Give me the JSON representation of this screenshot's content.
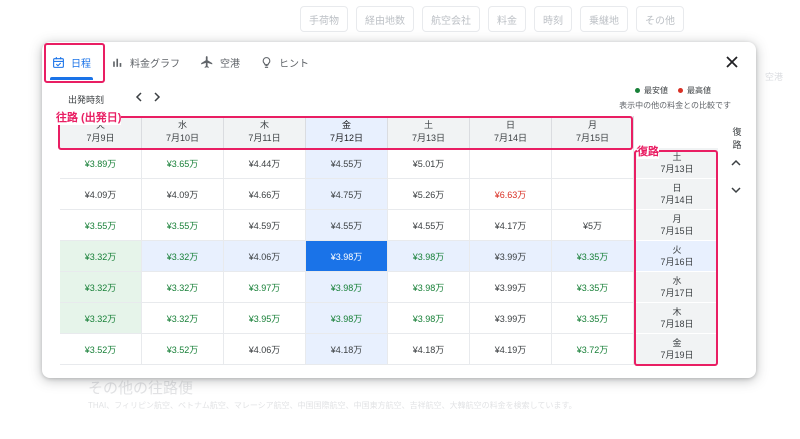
{
  "background": {
    "filters": [
      "手荷物",
      "経由地数",
      "航空会社",
      "料金",
      "時刻",
      "乗継地",
      "その他"
    ],
    "bottom_title": "その他の往路便",
    "bottom_sub": "THAI、フィリピン航空、ベトナム航空、マレーシア航空、中国国際航空、中国東方航空、吉祥航空、大韓航空の料金を検索しています。",
    "right_text": "空港"
  },
  "tabs": [
    {
      "label": "日程",
      "icon": "calendar-icon",
      "active": true
    },
    {
      "label": "料金グラフ",
      "icon": "bar-chart-icon",
      "active": false
    },
    {
      "label": "空港",
      "icon": "airplane-icon",
      "active": false
    },
    {
      "label": "ヒント",
      "icon": "lightbulb-icon",
      "active": false
    }
  ],
  "departure_time_label": "出発時刻",
  "legend": {
    "lowest": "最安値",
    "highest": "最高値",
    "lowest_color": "#188038",
    "highest_color": "#d93025"
  },
  "compare_note": "表示中の他の料金との比較です",
  "return_label": "復路",
  "columns": [
    {
      "day": "火",
      "date": "7月9日"
    },
    {
      "day": "水",
      "date": "7月10日"
    },
    {
      "day": "木",
      "date": "7月11日"
    },
    {
      "day": "金",
      "date": "7月12日"
    },
    {
      "day": "土",
      "date": "7月13日"
    },
    {
      "day": "日",
      "date": "7月14日"
    },
    {
      "day": "月",
      "date": "7月15日"
    }
  ],
  "rows": [
    {
      "day": "土",
      "date": "7月13日"
    },
    {
      "day": "日",
      "date": "7月14日"
    },
    {
      "day": "月",
      "date": "7月15日"
    },
    {
      "day": "火",
      "date": "7月16日"
    },
    {
      "day": "水",
      "date": "7月17日"
    },
    {
      "day": "木",
      "date": "7月18日"
    },
    {
      "day": "金",
      "date": "7月19日"
    }
  ],
  "prices": [
    [
      {
        "v": "¥3.89万",
        "c": "green"
      },
      {
        "v": "¥3.65万",
        "c": "green"
      },
      {
        "v": "¥4.44万",
        "c": "normal"
      },
      {
        "v": "¥4.55万",
        "c": "normal"
      },
      {
        "v": "¥5.01万",
        "c": "normal"
      },
      {
        "v": "",
        "c": "normal"
      },
      {
        "v": "",
        "c": "normal"
      }
    ],
    [
      {
        "v": "¥4.09万",
        "c": "normal"
      },
      {
        "v": "¥4.09万",
        "c": "normal"
      },
      {
        "v": "¥4.66万",
        "c": "normal"
      },
      {
        "v": "¥4.75万",
        "c": "normal"
      },
      {
        "v": "¥5.26万",
        "c": "normal"
      },
      {
        "v": "¥6.63万",
        "c": "red"
      },
      {
        "v": "",
        "c": "normal"
      }
    ],
    [
      {
        "v": "¥3.55万",
        "c": "green"
      },
      {
        "v": "¥3.55万",
        "c": "green"
      },
      {
        "v": "¥4.59万",
        "c": "normal"
      },
      {
        "v": "¥4.55万",
        "c": "normal"
      },
      {
        "v": "¥4.55万",
        "c": "normal"
      },
      {
        "v": "¥4.17万",
        "c": "normal"
      },
      {
        "v": "¥5万",
        "c": "normal"
      }
    ],
    [
      {
        "v": "¥3.32万",
        "c": "green"
      },
      {
        "v": "¥3.32万",
        "c": "green"
      },
      {
        "v": "¥4.06万",
        "c": "normal"
      },
      {
        "v": "¥3.98万",
        "c": "selected"
      },
      {
        "v": "¥3.98万",
        "c": "green"
      },
      {
        "v": "¥3.99万",
        "c": "normal"
      },
      {
        "v": "¥3.35万",
        "c": "green"
      }
    ],
    [
      {
        "v": "¥3.32万",
        "c": "green"
      },
      {
        "v": "¥3.32万",
        "c": "green"
      },
      {
        "v": "¥3.97万",
        "c": "green"
      },
      {
        "v": "¥3.98万",
        "c": "green"
      },
      {
        "v": "¥3.98万",
        "c": "green"
      },
      {
        "v": "¥3.99万",
        "c": "normal"
      },
      {
        "v": "¥3.35万",
        "c": "green"
      }
    ],
    [
      {
        "v": "¥3.32万",
        "c": "green"
      },
      {
        "v": "¥3.32万",
        "c": "green"
      },
      {
        "v": "¥3.95万",
        "c": "green"
      },
      {
        "v": "¥3.98万",
        "c": "green"
      },
      {
        "v": "¥3.98万",
        "c": "green"
      },
      {
        "v": "¥3.99万",
        "c": "normal"
      },
      {
        "v": "¥3.35万",
        "c": "green"
      }
    ],
    [
      {
        "v": "¥3.52万",
        "c": "green"
      },
      {
        "v": "¥3.52万",
        "c": "green"
      },
      {
        "v": "¥4.06万",
        "c": "normal"
      },
      {
        "v": "¥4.18万",
        "c": "normal"
      },
      {
        "v": "¥4.18万",
        "c": "normal"
      },
      {
        "v": "¥4.19万",
        "c": "normal"
      },
      {
        "v": "¥3.72万",
        "c": "green"
      }
    ]
  ],
  "annotations": {
    "outbound": "往路 (出発日)",
    "return": "復路"
  }
}
